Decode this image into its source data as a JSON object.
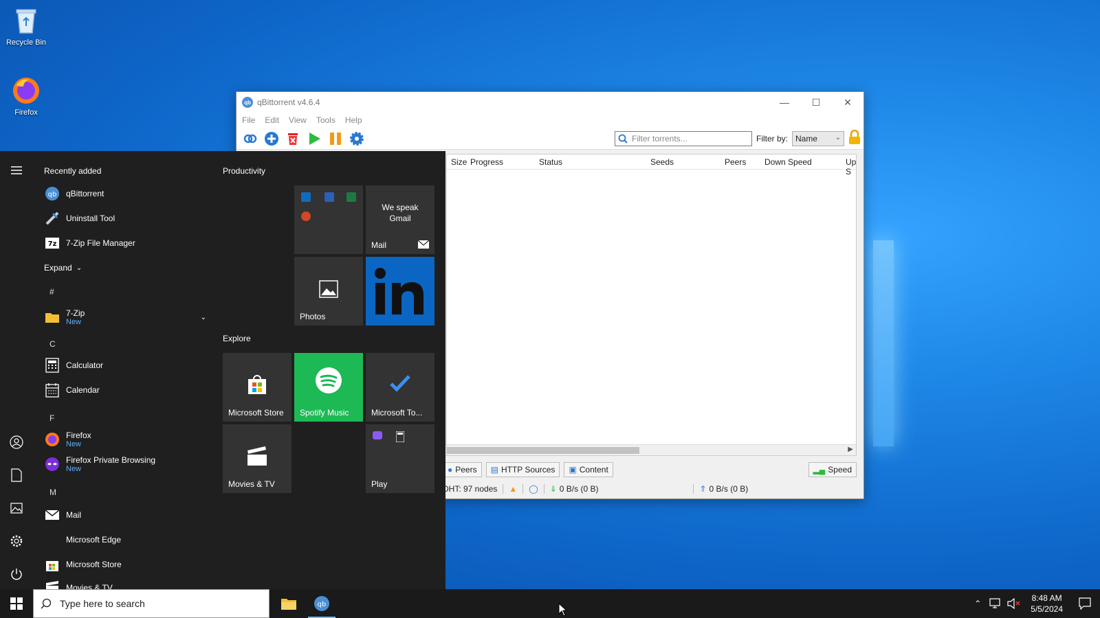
{
  "desktop": {
    "icons": [
      {
        "label": "Recycle Bin"
      },
      {
        "label": "Firefox"
      }
    ]
  },
  "qbt": {
    "title": "qBittorrent v4.6.4",
    "menu": [
      "File",
      "Edit",
      "View",
      "Tools",
      "Help"
    ],
    "filter_placeholder": "Filter torrents...",
    "filter_by_label": "Filter by:",
    "filter_by_value": "Name",
    "columns": [
      "Size",
      "Progress",
      "Status",
      "Seeds",
      "Peers",
      "Down Speed",
      "Up S"
    ],
    "tabs": [
      "Peers",
      "HTTP Sources",
      "Content"
    ],
    "speed_label": "Speed",
    "status": {
      "dht": "DHT: 97 nodes",
      "down": "0 B/s (0 B)",
      "up": "0 B/s (0 B)"
    }
  },
  "start": {
    "recently_added": "Recently added",
    "recent": [
      {
        "label": "qBittorrent"
      },
      {
        "label": "Uninstall Tool"
      },
      {
        "label": "7-Zip File Manager"
      }
    ],
    "expand": "Expand",
    "letters": {
      "hash": "#",
      "c": "C",
      "f": "F",
      "m": "M"
    },
    "apps": {
      "zip": {
        "label": "7-Zip",
        "sub": "New"
      },
      "calculator": {
        "label": "Calculator"
      },
      "calendar": {
        "label": "Calendar"
      },
      "firefox": {
        "label": "Firefox",
        "sub": "New"
      },
      "firefox_private": {
        "label": "Firefox Private Browsing",
        "sub": "New"
      },
      "mail": {
        "label": "Mail"
      },
      "edge": {
        "label": "Microsoft Edge"
      },
      "store": {
        "label": "Microsoft Store"
      },
      "movies": {
        "label": "Movies & TV"
      }
    },
    "productivity": "Productivity",
    "explore": "Explore",
    "tiles": {
      "mail_text": "We speak Gmail",
      "mail": "Mail",
      "photos": "Photos",
      "store": "Microsoft Store",
      "spotify": "Spotify Music",
      "todo": "Microsoft To...",
      "movies": "Movies & TV",
      "play": "Play"
    }
  },
  "taskbar": {
    "search_placeholder": "Type here to search",
    "time": "8:48 AM",
    "date": "5/5/2024"
  },
  "colors": {
    "spotify": "#1db954",
    "linkedin": "#0a66c2",
    "desktop": "#1576d6"
  }
}
